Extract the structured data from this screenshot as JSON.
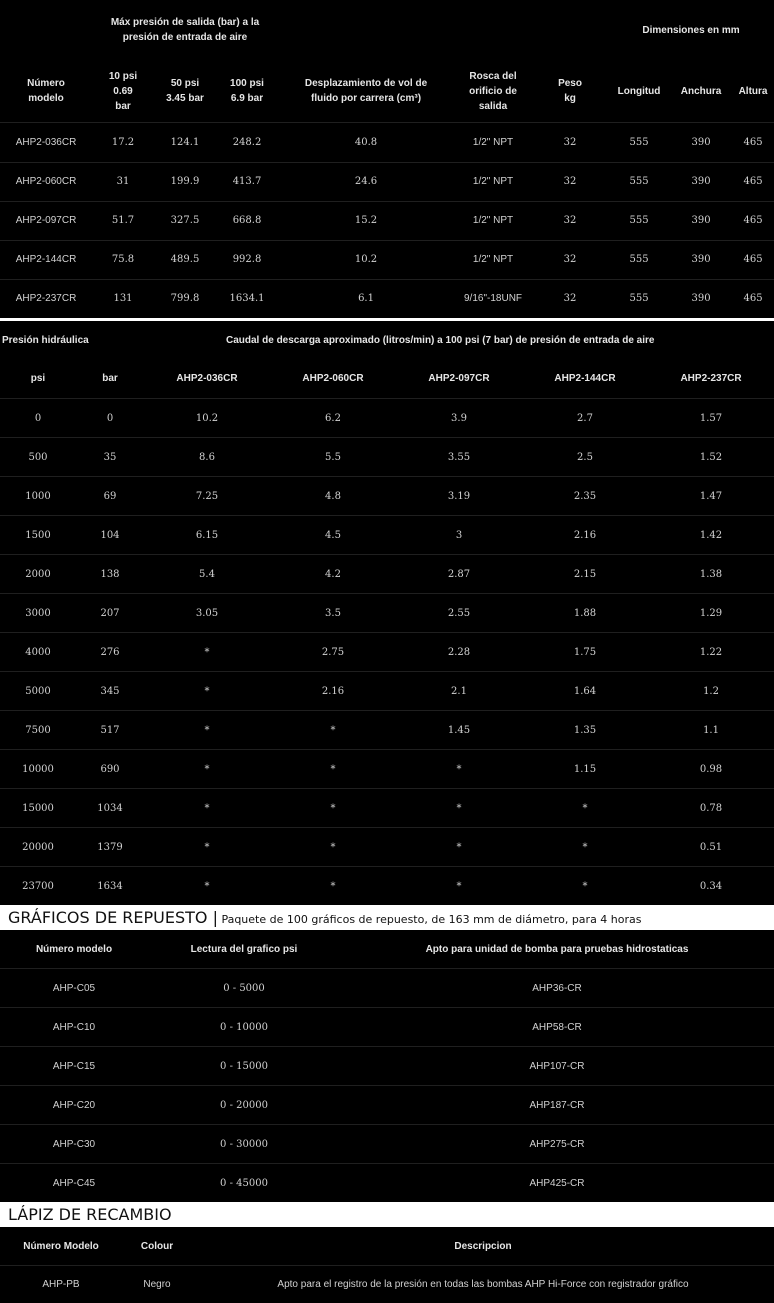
{
  "table1": {
    "headers": {
      "max_pressure": "Máx presión de salida (bar) a la presión de entrada de aire",
      "dimensions": "Dimensiones en mm",
      "model": "Número modelo",
      "p10": "10 psi 0.69 bar",
      "p50": "50 psi 3.45 bar",
      "p100": "100 psi 6.9 bar",
      "displacement": "Desplazamiento de vol de fluido por carrera (cm³)",
      "thread": "Rosca del orificio de salida",
      "weight": "Peso kg",
      "length": "Longitud",
      "width": "Anchura",
      "height": "Altura"
    },
    "rows": [
      [
        "AHP2-036CR",
        "17.2",
        "124.1",
        "248.2",
        "40.8",
        "1/2\" NPT",
        "32",
        "555",
        "390",
        "465"
      ],
      [
        "AHP2-060CR",
        "31",
        "199.9",
        "413.7",
        "24.6",
        "1/2\" NPT",
        "32",
        "555",
        "390",
        "465"
      ],
      [
        "AHP2-097CR",
        "51.7",
        "327.5",
        "668.8",
        "15.2",
        "1/2\" NPT",
        "32",
        "555",
        "390",
        "465"
      ],
      [
        "AHP2-144CR",
        "75.8",
        "489.5",
        "992.8",
        "10.2",
        "1/2\" NPT",
        "32",
        "555",
        "390",
        "465"
      ],
      [
        "AHP2-237CR",
        "131",
        "799.8",
        "1634.1",
        "6.1",
        "9/16\"-18UNF",
        "32",
        "555",
        "390",
        "465"
      ]
    ]
  },
  "table2": {
    "headers": {
      "hydraulic": "Presión hidráulica",
      "flow": "Caudal de descarga aproximado (litros/min) a 100 psi (7 bar) de presión de entrada de aire",
      "psi": "psi",
      "bar": "bar",
      "m1": "AHP2-036CR",
      "m2": "AHP2-060CR",
      "m3": "AHP2-097CR",
      "m4": "AHP2-144CR",
      "m5": "AHP2-237CR"
    },
    "rows": [
      [
        "0",
        "0",
        "10.2",
        "6.2",
        "3.9",
        "2.7",
        "1.57"
      ],
      [
        "500",
        "35",
        "8.6",
        "5.5",
        "3.55",
        "2.5",
        "1.52"
      ],
      [
        "1000",
        "69",
        "7.25",
        "4.8",
        "3.19",
        "2.35",
        "1.47"
      ],
      [
        "1500",
        "104",
        "6.15",
        "4.5",
        "3",
        "2.16",
        "1.42"
      ],
      [
        "2000",
        "138",
        "5.4",
        "4.2",
        "2.87",
        "2.15",
        "1.38"
      ],
      [
        "3000",
        "207",
        "3.05",
        "3.5",
        "2.55",
        "1.88",
        "1.29"
      ],
      [
        "4000",
        "276",
        "*",
        "2.75",
        "2.28",
        "1.75",
        "1.22"
      ],
      [
        "5000",
        "345",
        "*",
        "2.16",
        "2.1",
        "1.64",
        "1.2"
      ],
      [
        "7500",
        "517",
        "*",
        "*",
        "1.45",
        "1.35",
        "1.1"
      ],
      [
        "10000",
        "690",
        "*",
        "*",
        "*",
        "1.15",
        "0.98"
      ],
      [
        "15000",
        "1034",
        "*",
        "*",
        "*",
        "*",
        "0.78"
      ],
      [
        "20000",
        "1379",
        "*",
        "*",
        "*",
        "*",
        "0.51"
      ],
      [
        "23700",
        "1634",
        "*",
        "*",
        "*",
        "*",
        "0.34"
      ]
    ]
  },
  "charts_section": {
    "title": "GRÁFICOS DE REPUESTO |",
    "subtitle": " Paquete de 100 gráficos de repuesto, de 163 mm de diámetro, para 4 horas",
    "headers": {
      "model": "Número modelo",
      "reading": "Lectura del grafico psi",
      "fits": "Apto para unidad de bomba para pruebas hidrostaticas"
    },
    "rows": [
      [
        "AHP-C05",
        "0 - 5000",
        "AHP36-CR"
      ],
      [
        "AHP-C10",
        "0 - 10000",
        "AHP58-CR"
      ],
      [
        "AHP-C15",
        "0 - 15000",
        "AHP107-CR"
      ],
      [
        "AHP-C20",
        "0 - 20000",
        "AHP187-CR"
      ],
      [
        "AHP-C30",
        "0 - 30000",
        "AHP275-CR"
      ],
      [
        "AHP-C45",
        "0 - 45000",
        "AHP425-CR"
      ]
    ]
  },
  "pen_section": {
    "title": "LÁPIZ DE RECAMBIO",
    "headers": {
      "model": "Número Modelo",
      "colour": "Colour",
      "description": "Descripcion"
    },
    "rows": [
      [
        "AHP-PB",
        "Negro",
        "Apto para el registro de la presión en todas las bombas AHP Hi-Force con registrador gráfico"
      ]
    ]
  }
}
